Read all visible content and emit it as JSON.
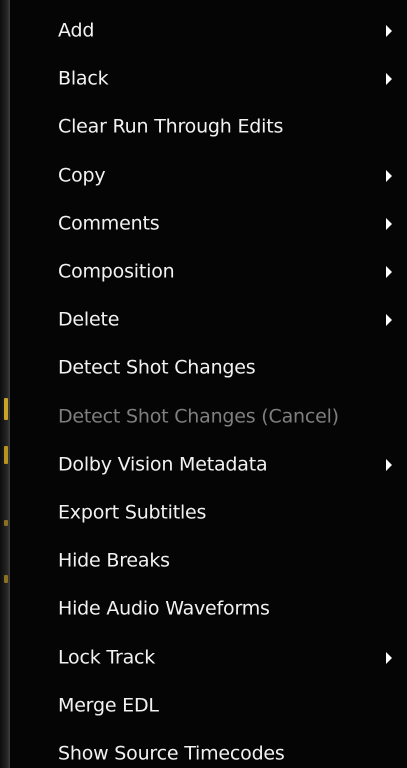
{
  "context_menu": {
    "items": [
      {
        "label": "Add",
        "has_submenu": true,
        "enabled": true
      },
      {
        "label": "Black",
        "has_submenu": true,
        "enabled": true
      },
      {
        "label": "Clear Run Through Edits",
        "has_submenu": false,
        "enabled": true
      },
      {
        "label": "Copy",
        "has_submenu": true,
        "enabled": true
      },
      {
        "label": "Comments",
        "has_submenu": true,
        "enabled": true
      },
      {
        "label": "Composition",
        "has_submenu": true,
        "enabled": true
      },
      {
        "label": "Delete",
        "has_submenu": true,
        "enabled": true
      },
      {
        "label": "Detect Shot Changes",
        "has_submenu": false,
        "enabled": true
      },
      {
        "label": "Detect Shot Changes (Cancel)",
        "has_submenu": false,
        "enabled": false
      },
      {
        "label": "Dolby Vision Metadata",
        "has_submenu": true,
        "enabled": true
      },
      {
        "label": "Export Subtitles",
        "has_submenu": false,
        "enabled": true
      },
      {
        "label": "Hide Breaks",
        "has_submenu": false,
        "enabled": true
      },
      {
        "label": "Hide Audio Waveforms",
        "has_submenu": false,
        "enabled": true
      },
      {
        "label": "Lock Track",
        "has_submenu": true,
        "enabled": true
      },
      {
        "label": "Merge EDL",
        "has_submenu": false,
        "enabled": true
      },
      {
        "label": "Show Source Timecodes",
        "has_submenu": false,
        "enabled": true
      }
    ]
  },
  "colors": {
    "menu_background": "#050505",
    "text_enabled": "#f2f2f2",
    "text_disabled": "#7f7f7f",
    "arrow": "#ffffff",
    "background_waveform_accent": "#c9a227"
  }
}
